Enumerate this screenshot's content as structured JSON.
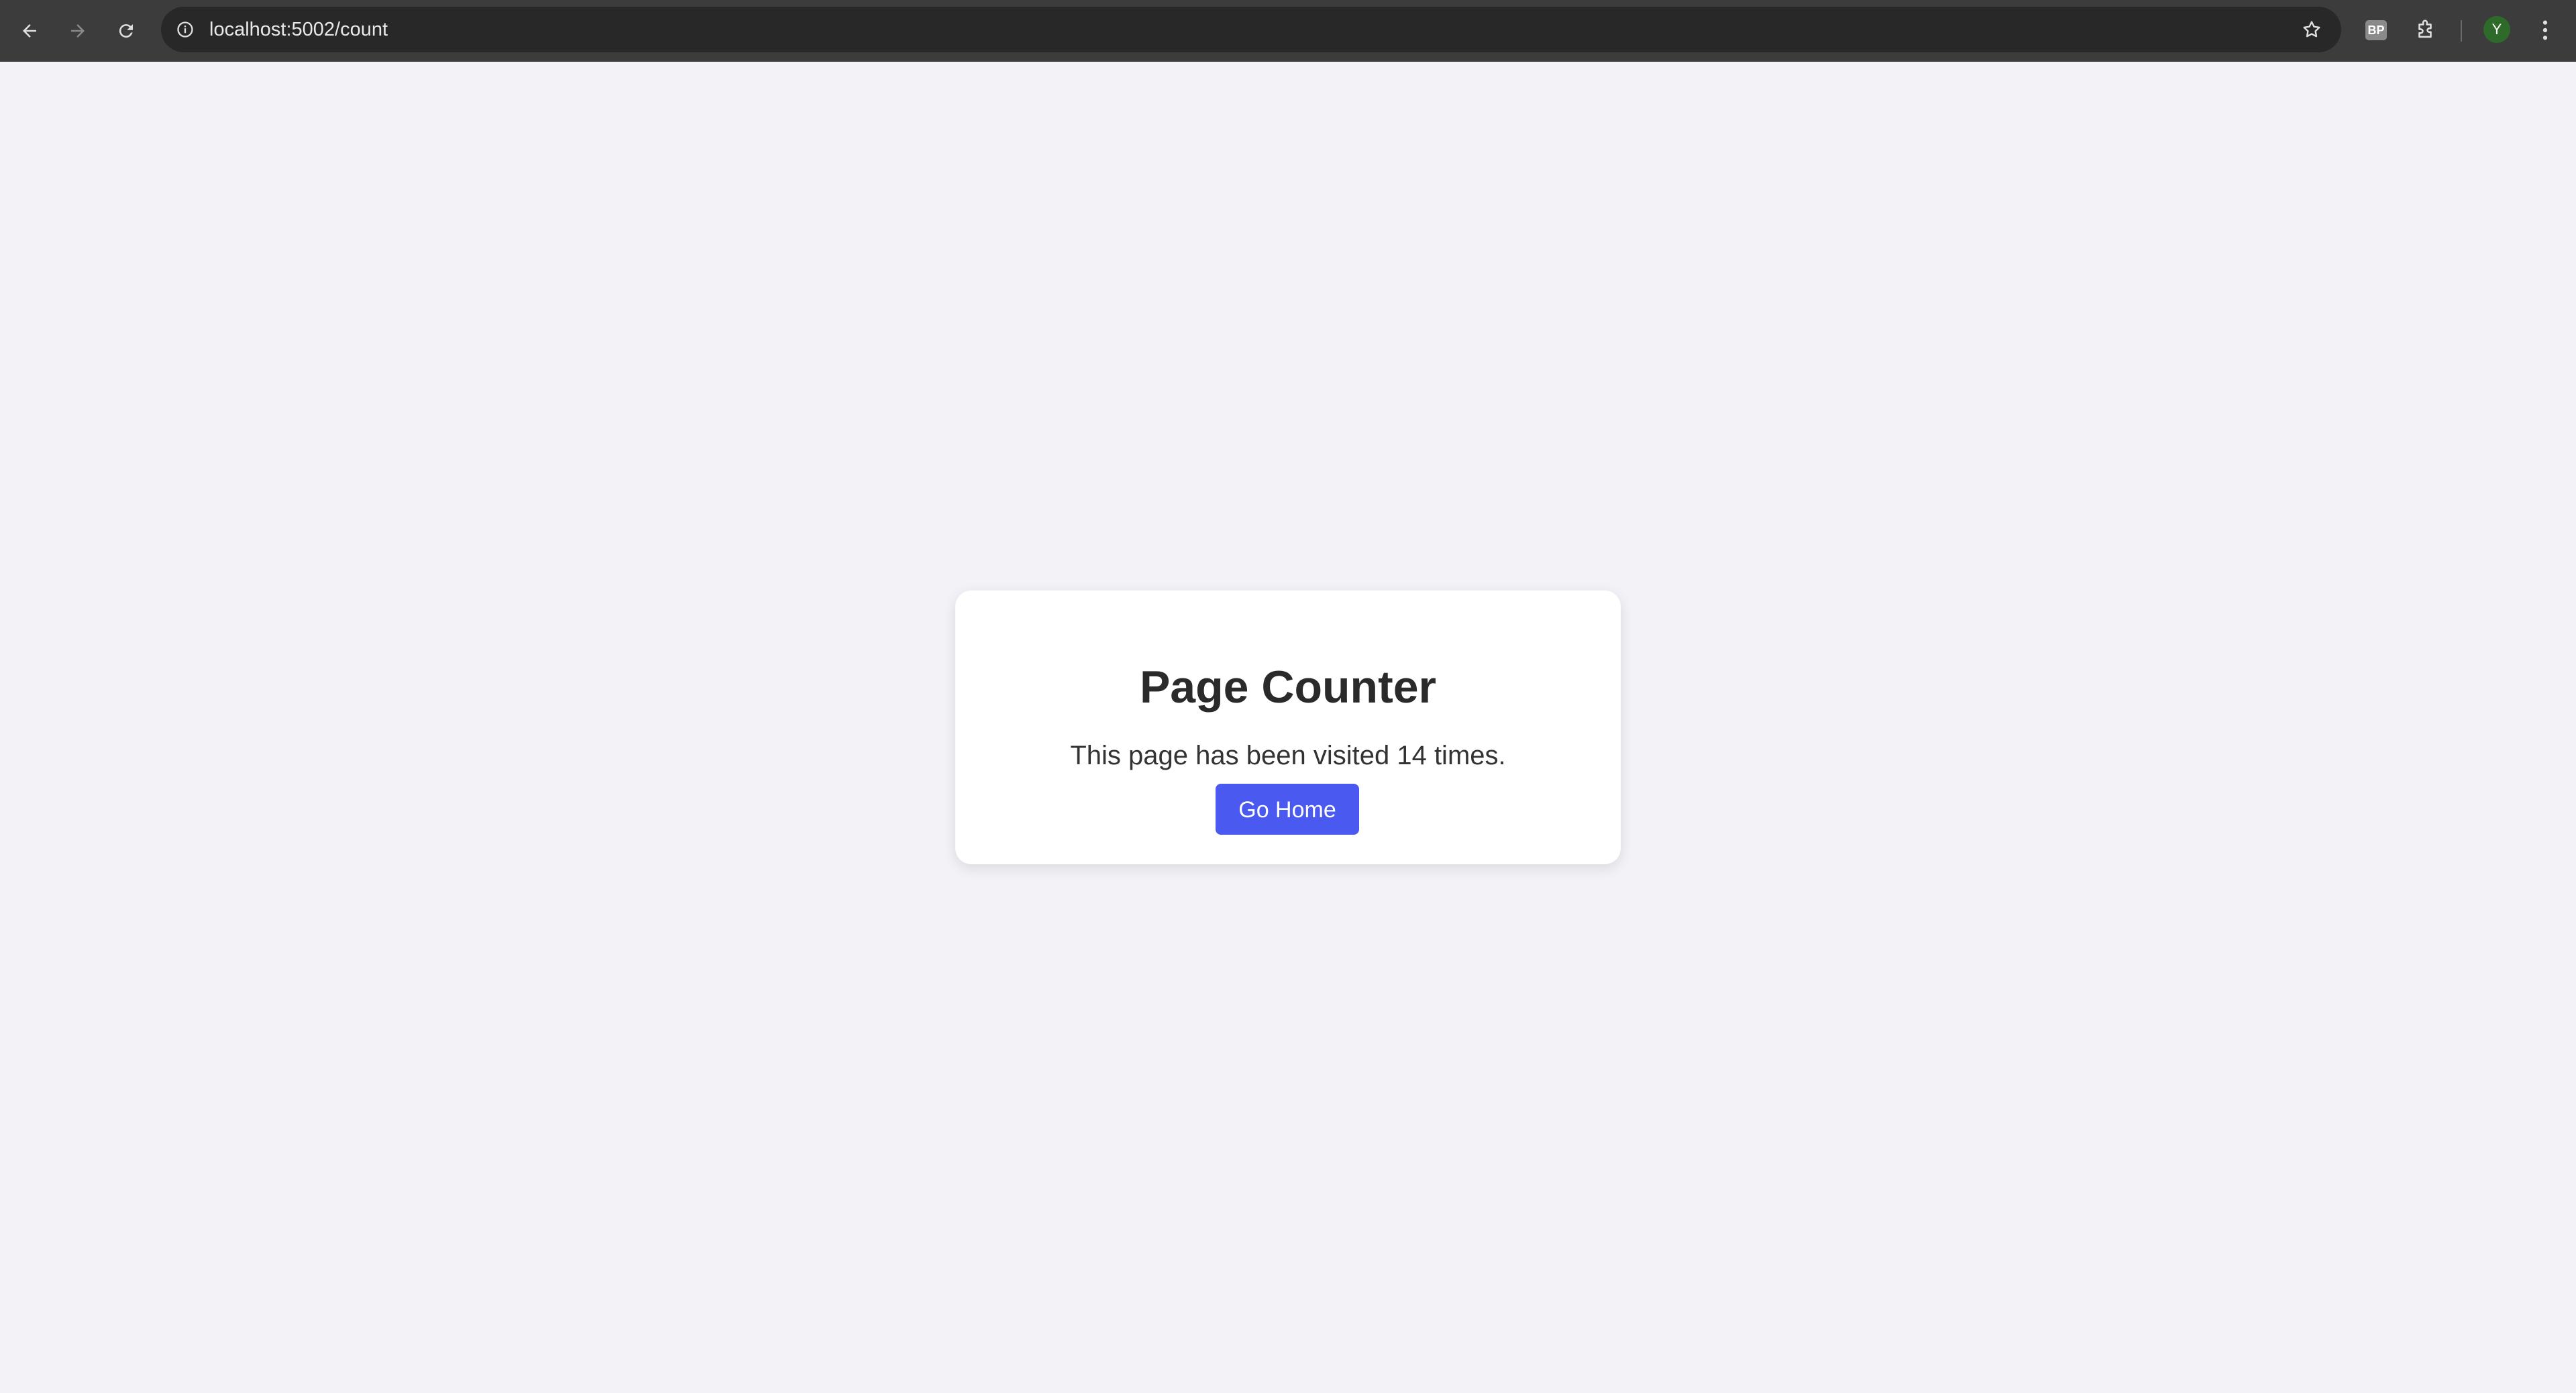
{
  "browser": {
    "url": "localhost:5002/count",
    "extension_badge": "BP",
    "profile_initial": "Y",
    "icons": [
      "back-arrow-icon",
      "forward-arrow-icon",
      "reload-icon",
      "info-icon",
      "star-icon",
      "puzzle-icon",
      "kebab-menu-icon"
    ],
    "toolbar_color": "#3c3c3c",
    "avatar_color": "#2e6b2a"
  },
  "card": {
    "title": "Page Counter",
    "message": "This page has been visited 14 times.",
    "button_label": "Go Home",
    "button_color": "#4a5af0"
  },
  "page": {
    "background": "#f2f2f7"
  }
}
